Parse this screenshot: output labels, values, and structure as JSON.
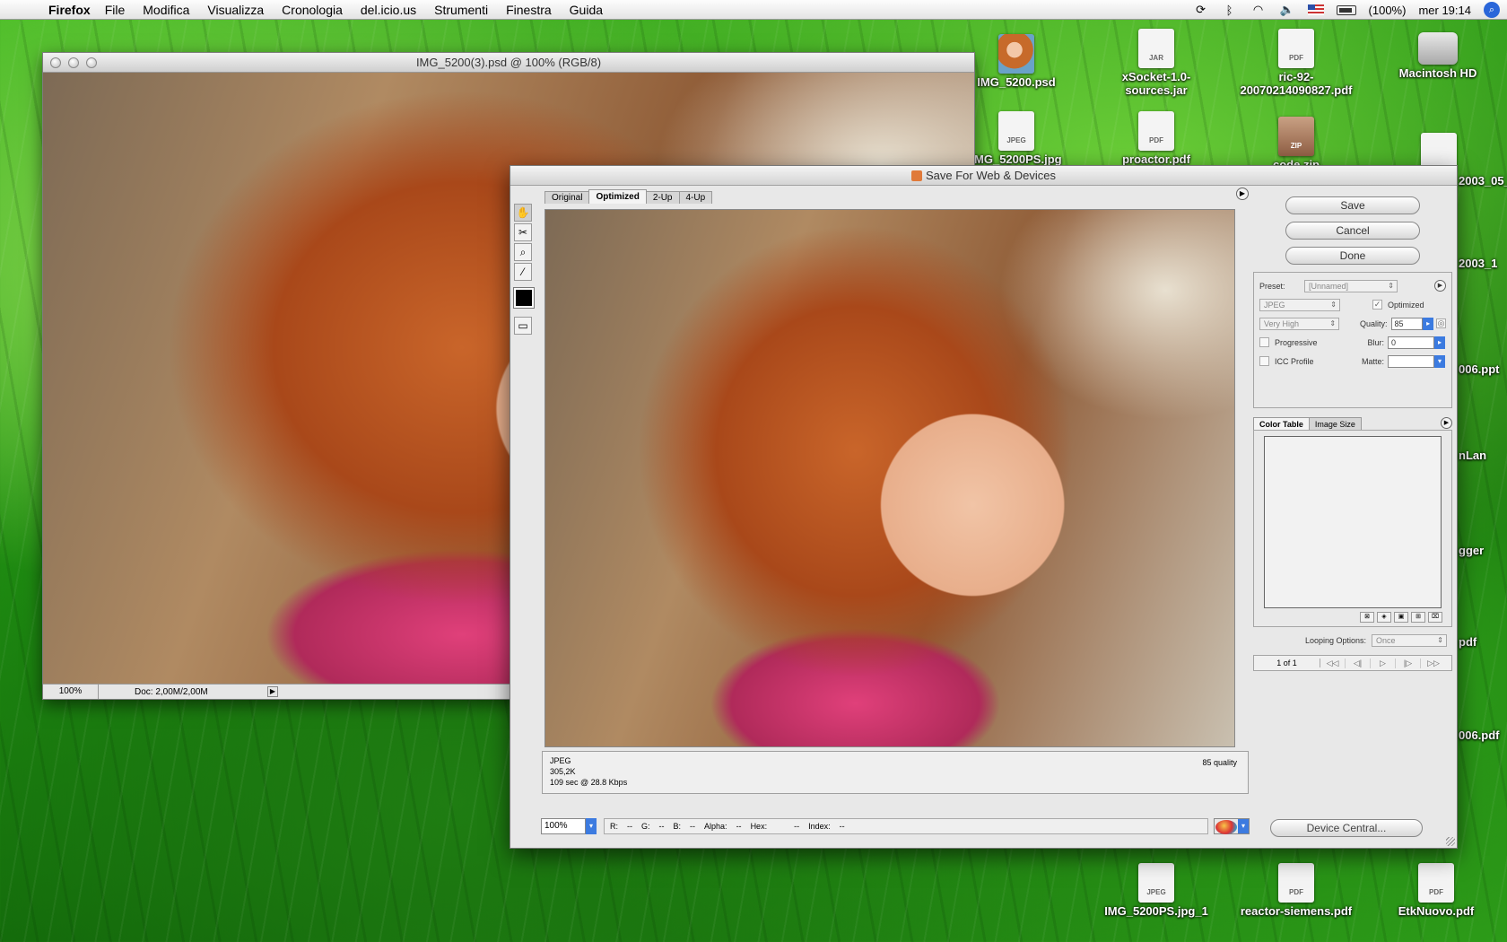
{
  "menubar": {
    "app": "Firefox",
    "items": [
      "File",
      "Modifica",
      "Visualizza",
      "Cronologia",
      "del.icio.us",
      "Strumenti",
      "Finestra",
      "Guida"
    ],
    "battery": "(100%)",
    "clock": "mer 19:14"
  },
  "desktop": {
    "icons": [
      {
        "label": "IMG_5200.psd",
        "kind": "photo"
      },
      {
        "label": "xSocket-1.0-sources.jar",
        "kind": "JAR"
      },
      {
        "label": "ric-92-20070214090827.pdf",
        "kind": "PDF"
      },
      {
        "label": "Macintosh HD",
        "kind": "hd"
      },
      {
        "label": "IMG_5200PS.jpg",
        "kind": "JPEG"
      },
      {
        "label": "proactor.pdf",
        "kind": "PDF"
      },
      {
        "label": "code.zip",
        "kind": "ZIP"
      },
      {
        "label": "2003_05_",
        "kind": "doc"
      },
      {
        "label": "2003_1",
        "kind": "doc"
      },
      {
        "label": "006.ppt",
        "kind": "doc"
      },
      {
        "label": "nLan",
        "kind": "doc"
      },
      {
        "label": "gger",
        "kind": "doc"
      },
      {
        "label": "pdf",
        "kind": "doc"
      },
      {
        "label": "006.pdf",
        "kind": "doc"
      },
      {
        "label": "IMG_5200PS.jpg_1",
        "kind": "JPEG"
      },
      {
        "label": "reactor-siemens.pdf",
        "kind": "PDF"
      },
      {
        "label": "EtkNuovo.pdf",
        "kind": "PDF"
      }
    ]
  },
  "docwindow": {
    "title": "IMG_5200(3).psd @ 100% (RGB/8)",
    "zoom": "100%",
    "doc_size": "Doc: 2,00M/2,00M"
  },
  "dialog": {
    "title": "Save For Web & Devices",
    "tabs": [
      "Original",
      "Optimized",
      "2-Up",
      "4-Up"
    ],
    "active_tab": "Optimized",
    "buttons": {
      "save": "Save",
      "cancel": "Cancel",
      "done": "Done",
      "device_central": "Device Central..."
    },
    "settings": {
      "preset_label": "Preset:",
      "preset_value": "[Unnamed]",
      "format": "JPEG",
      "quality_preset": "Very High",
      "optimized_label": "Optimized",
      "quality_label": "Quality:",
      "quality_value": "85",
      "progressive_label": "Progressive",
      "blur_label": "Blur:",
      "blur_value": "0",
      "icc_label": "ICC Profile",
      "matte_label": "Matte:"
    },
    "panel_tabs": [
      "Color Table",
      "Image Size"
    ],
    "looping_label": "Looping Options:",
    "looping_value": "Once",
    "frame_count": "1 of 1",
    "preview_info": {
      "format": "JPEG",
      "size": "305,2K",
      "download": "109 sec @ 28.8 Kbps",
      "quality": "85 quality"
    },
    "bottom": {
      "zoom": "100%",
      "r": "R:",
      "r_val": "--",
      "g": "G:",
      "g_val": "--",
      "b": "B:",
      "b_val": "--",
      "alpha": "Alpha:",
      "alpha_val": "--",
      "hex": "Hex:",
      "hex_val": "--",
      "index": "Index:",
      "index_val": "--"
    }
  }
}
